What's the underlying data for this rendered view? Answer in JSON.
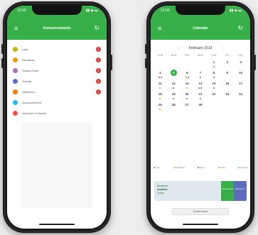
{
  "left_phone": {
    "status": {
      "time": "12:00",
      "icons": "▮▮ ◆ ▬"
    },
    "header": {
      "title": "Announcements",
      "menu_icon": "≡",
      "refresh_icon": "↻"
    },
    "items": [
      {
        "label": "Labs",
        "color": "#c6b400",
        "badge": "1"
      },
      {
        "label": "Deadlines",
        "color": "#e8a000",
        "badge": "1"
      },
      {
        "label": "School Event",
        "color": "#b06ab3",
        "badge": "1"
      },
      {
        "label": "Tutorial",
        "color": "#5c6bc0",
        "badge": "1"
      },
      {
        "label": "Deflection",
        "color": "#f57c00",
        "badge": "1"
      },
      {
        "label": "Announcement",
        "color": "#29b6f6",
        "badge": ""
      },
      {
        "label": "Instructor Contents",
        "color": "#ef5350",
        "badge": ""
      }
    ]
  },
  "right_phone": {
    "status": {
      "time": "12:00",
      "icons": "▮▮ ◆ ▬"
    },
    "header": {
      "title": "Calendar",
      "menu_icon": "≡",
      "refresh_icon": "↻"
    },
    "month_label": "February 2019",
    "prev_arrow": "‹",
    "next_arrow": "›",
    "weekdays": [
      "SUN",
      "MON",
      "TUE",
      "WED",
      "THU",
      "FRI",
      "SAT"
    ],
    "days": [
      {
        "n": "",
        "dots": []
      },
      {
        "n": "",
        "dots": []
      },
      {
        "n": "",
        "dots": []
      },
      {
        "n": "",
        "dots": []
      },
      {
        "n": "1",
        "dots": [
          "#5c6bc0"
        ]
      },
      {
        "n": "2",
        "dots": []
      },
      {
        "n": "3",
        "dots": []
      },
      {
        "n": "4",
        "dots": [
          "#e53935",
          "#5c6bc0"
        ]
      },
      {
        "n": "5",
        "dots": [],
        "selected": true
      },
      {
        "n": "6",
        "dots": [
          "#f57c00",
          "#5c6bc0"
        ]
      },
      {
        "n": "7",
        "dots": [
          "#5c6bc0"
        ]
      },
      {
        "n": "8",
        "dots": [
          "#5c6bc0"
        ]
      },
      {
        "n": "9",
        "dots": []
      },
      {
        "n": "10",
        "dots": []
      },
      {
        "n": "11",
        "dots": [
          "#e8a000"
        ]
      },
      {
        "n": "12",
        "dots": [
          "#5c6bc0"
        ]
      },
      {
        "n": "13",
        "dots": [
          "#c6b400"
        ]
      },
      {
        "n": "14",
        "dots": [
          "#5c6bc0",
          "#e53935"
        ]
      },
      {
        "n": "15",
        "dots": [
          "#5c6bc0"
        ]
      },
      {
        "n": "16",
        "dots": []
      },
      {
        "n": "17",
        "dots": []
      },
      {
        "n": "18",
        "dots": [
          "#e8a000"
        ]
      },
      {
        "n": "19",
        "dots": [
          "#5c6bc0"
        ]
      },
      {
        "n": "20",
        "dots": [
          "#e53935"
        ]
      },
      {
        "n": "21",
        "dots": [
          "#5c6bc0"
        ]
      },
      {
        "n": "22",
        "dots": []
      },
      {
        "n": "23",
        "dots": []
      },
      {
        "n": "24",
        "dots": []
      },
      {
        "n": "25",
        "dots": [
          "#e8a000"
        ]
      },
      {
        "n": "26",
        "dots": []
      },
      {
        "n": "27",
        "dots": []
      },
      {
        "n": "28",
        "dots": []
      },
      {
        "n": "",
        "dots": []
      },
      {
        "n": "",
        "dots": []
      },
      {
        "n": "",
        "dots": []
      }
    ],
    "legend": [
      {
        "label": "Labs",
        "color": "#e53935"
      },
      {
        "label": "Deadlines",
        "color": "#e8a000"
      },
      {
        "label": "Event",
        "color": "#5c6bc0"
      },
      {
        "label": "Class",
        "color": "#c6b400"
      },
      {
        "label": "Tutorial",
        "color": "#29b6f6"
      }
    ],
    "event": {
      "category": "Deadlines",
      "title": "Deadline",
      "time": "Today",
      "view_label": "View Event",
      "edit_label": "Edit Event"
    },
    "create_button": "Create Event"
  },
  "colors": {
    "accent": "#37b04a"
  }
}
